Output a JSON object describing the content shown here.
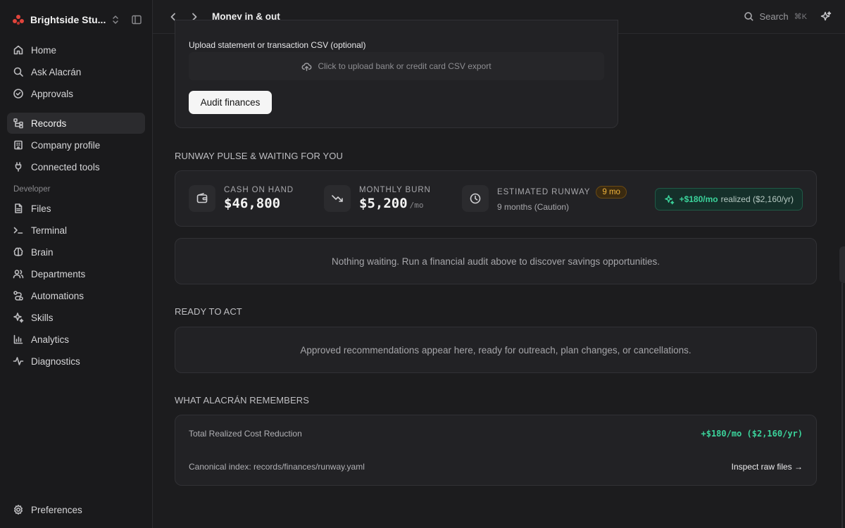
{
  "workspace": {
    "name": "Brightside Stu..."
  },
  "sidebar": {
    "items": [
      {
        "label": "Home",
        "icon": "home-icon"
      },
      {
        "label": "Ask Alacrán",
        "icon": "search-icon"
      },
      {
        "label": "Approvals",
        "icon": "check-circle-icon"
      }
    ],
    "items2": [
      {
        "label": "Records",
        "icon": "records-tree-icon",
        "active": true
      },
      {
        "label": "Company profile",
        "icon": "building-icon"
      },
      {
        "label": "Connected tools",
        "icon": "plug-icon"
      }
    ],
    "developer_label": "Developer",
    "dev_items": [
      {
        "label": "Files",
        "icon": "file-icon"
      },
      {
        "label": "Terminal",
        "icon": "terminal-icon"
      },
      {
        "label": "Brain",
        "icon": "brain-icon"
      },
      {
        "label": "Departments",
        "icon": "users-icon"
      },
      {
        "label": "Automations",
        "icon": "workflow-icon"
      },
      {
        "label": "Skills",
        "icon": "sparkles-icon"
      },
      {
        "label": "Analytics",
        "icon": "bar-chart-icon"
      },
      {
        "label": "Diagnostics",
        "icon": "activity-icon"
      }
    ],
    "preferences": "Preferences"
  },
  "topbar": {
    "title": "Money in & out",
    "search_label": "Search",
    "search_shortcut": "⌘K"
  },
  "upload": {
    "label": "Upload statement or transaction CSV (optional)",
    "dropzone_text": "Click to upload bank or credit card CSV export",
    "audit_button": "Audit finances"
  },
  "pulse": {
    "title": "RUNWAY PULSE & WAITING FOR YOU",
    "cash": {
      "label": "CASH ON HAND",
      "value": "$46,800"
    },
    "burn": {
      "label": "MONTHLY BURN",
      "value": "$5,200",
      "unit": "/mo"
    },
    "runway": {
      "label": "ESTIMATED RUNWAY",
      "badge": "9 mo",
      "sub": "9 months (Caution)"
    },
    "realized": {
      "amount": "+$180/mo",
      "rest": "realized ($2,160/yr)"
    },
    "empty_text": "Nothing waiting. Run a financial audit above to discover savings opportunities."
  },
  "ready": {
    "title": "READY TO ACT",
    "empty_text": "Approved recommendations appear here, ready for outreach, plan changes, or cancellations."
  },
  "memory": {
    "title": "WHAT ALACRÁN REMEMBERS",
    "total_label": "Total Realized Cost Reduction",
    "total_value": "+$180/mo ($2,160/yr)",
    "index_label": "Canonical index: records/finances/runway.yaml",
    "inspect_link": "Inspect raw files →"
  },
  "colors": {
    "accent_green": "#3bd39b",
    "amber": "#f0b43c",
    "logo_red": "#e0443c"
  }
}
